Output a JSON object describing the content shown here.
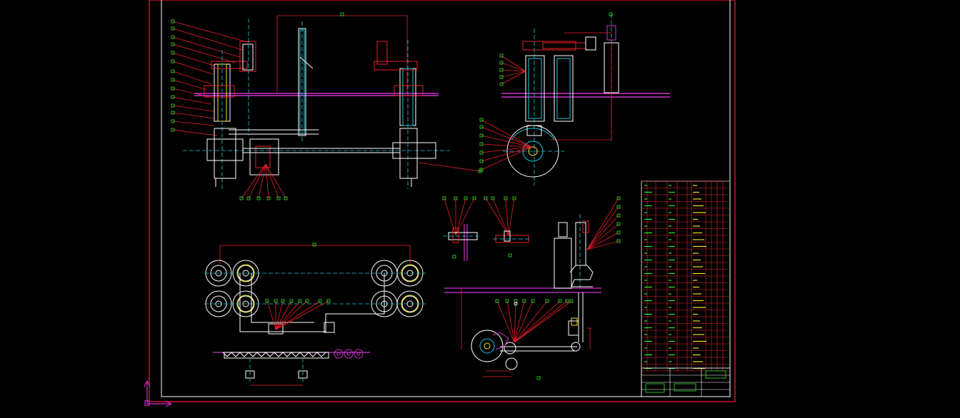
{
  "app": {
    "type": "CAD drawing viewport",
    "background": "#000000"
  },
  "colors": {
    "red": "#e8202a",
    "white": "#ffffff",
    "cyan": "#19c6d6",
    "green": "#2ee82e",
    "yellow": "#f0e020",
    "magenta": "#cc33cc",
    "frame": "#d01030",
    "axis": "#b040d0"
  },
  "views": [
    {
      "name": "front-elevation-view"
    },
    {
      "name": "side-elevation-view"
    },
    {
      "name": "plan-view"
    },
    {
      "name": "detail-section-view"
    },
    {
      "name": "mechanism-view"
    }
  ],
  "title_block": {
    "present": true,
    "parts_list_rows": 28
  },
  "ucs_icon": {
    "name": "ucs-axis-icon"
  }
}
